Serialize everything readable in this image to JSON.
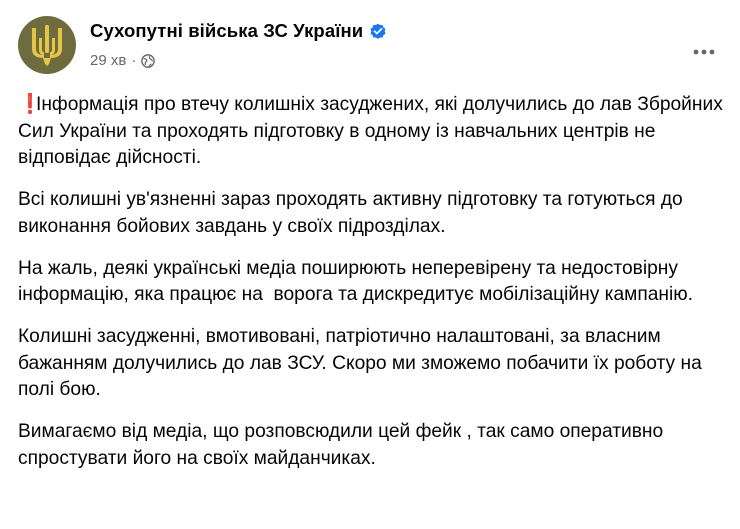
{
  "post": {
    "author": {
      "name": "Сухопутні війська ЗС України",
      "verified": true,
      "avatar_icon": "trident-emblem-icon",
      "avatar_bg": "#6e6b3f",
      "emblem_color": "#e6c44a"
    },
    "meta": {
      "time": "29 хв",
      "separator": "·",
      "audience_icon": "globe-icon"
    },
    "more_icon": "more-options-icon",
    "paragraphs": [
      {
        "prefix": "❗",
        "text": "Інформація про втечу колишніх засуджених, які долучились до лав Збройних Сил України та проходять підготовку в одному із навчальних центрів не відповідає дійсності."
      },
      {
        "text": "Всі колишні ув'язненні зараз проходять активну підготовку та готуються до виконання бойових завдань у своїх підрозділах."
      },
      {
        "text": "На жаль, деякі українські медіа поширюють неперевірену та недостовірну інформацію, яка працює на  ворога та дискредитує мобілізаційну кампанію."
      },
      {
        "text": "Колишні засудженні, вмотивовані, патріотично налаштовані, за власним бажанням долучились до лав ЗСУ. Скоро ми зможемо побачити їх роботу на полі бою."
      },
      {
        "text": "Вимагаємо від медіа, що розповсюдили цей фейк , так само оперативно спростувати його на своїх майданчиках."
      }
    ]
  },
  "colors": {
    "text": "#050505",
    "secondary": "#65676b",
    "verified": "#1877f2",
    "exclaim": "#e0262c"
  }
}
